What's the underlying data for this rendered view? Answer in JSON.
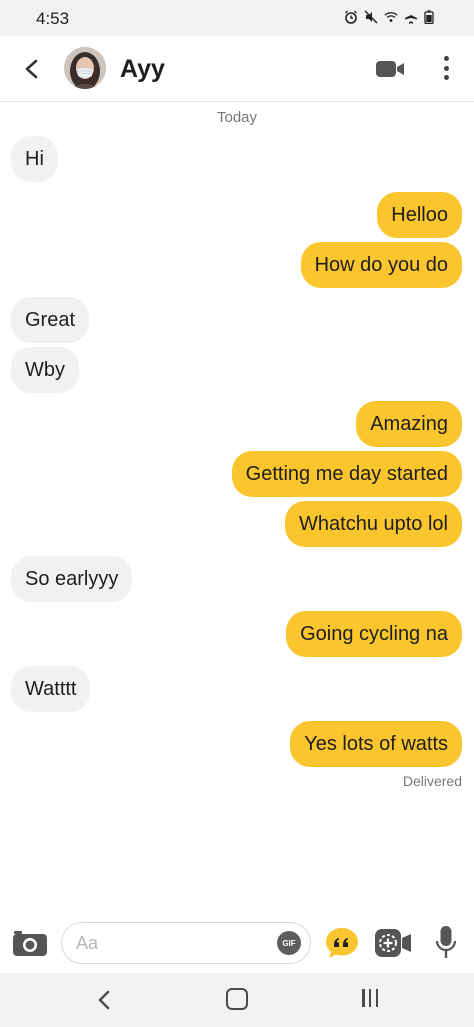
{
  "status_bar": {
    "time": "4:53",
    "icons": [
      "alarm-icon",
      "mute-icon",
      "wifi-icon",
      "airplane-icon",
      "battery-icon"
    ]
  },
  "header": {
    "back_icon": "chevron-left-icon",
    "contact_name": "Ayy",
    "video_icon": "video-camera-icon",
    "more_icon": "more-vertical-icon"
  },
  "conversation": {
    "day_label": "Today",
    "messages": [
      {
        "direction": "incoming",
        "text": "Hi"
      },
      {
        "direction": "outgoing",
        "text": "Helloo"
      },
      {
        "direction": "outgoing",
        "text": "How do you do"
      },
      {
        "direction": "incoming",
        "text": "Great"
      },
      {
        "direction": "incoming",
        "text": "Wby"
      },
      {
        "direction": "outgoing",
        "text": "Amazing"
      },
      {
        "direction": "outgoing",
        "text": "Getting me day started"
      },
      {
        "direction": "outgoing",
        "text": "Whatchu upto lol"
      },
      {
        "direction": "incoming",
        "text": "So earlyyy"
      },
      {
        "direction": "outgoing",
        "text": "Going cycling na"
      },
      {
        "direction": "incoming",
        "text": "Watttt"
      },
      {
        "direction": "outgoing",
        "text": "Yes lots of watts"
      }
    ],
    "delivery_status": "Delivered"
  },
  "composer": {
    "camera_icon": "camera-icon",
    "input_placeholder": "Aa",
    "input_value": "",
    "gif_label": "GIF",
    "quote_icon": "quote-icon",
    "media_icon": "add-media-icon",
    "mic_icon": "microphone-icon"
  },
  "nav_bar": {
    "back_icon": "nav-back-icon",
    "home_icon": "nav-home-icon",
    "recents_icon": "nav-recents-icon"
  },
  "colors": {
    "accent": "#fbc52d",
    "incoming_bubble": "#f1f1f1",
    "text": "#1e1e1e"
  }
}
